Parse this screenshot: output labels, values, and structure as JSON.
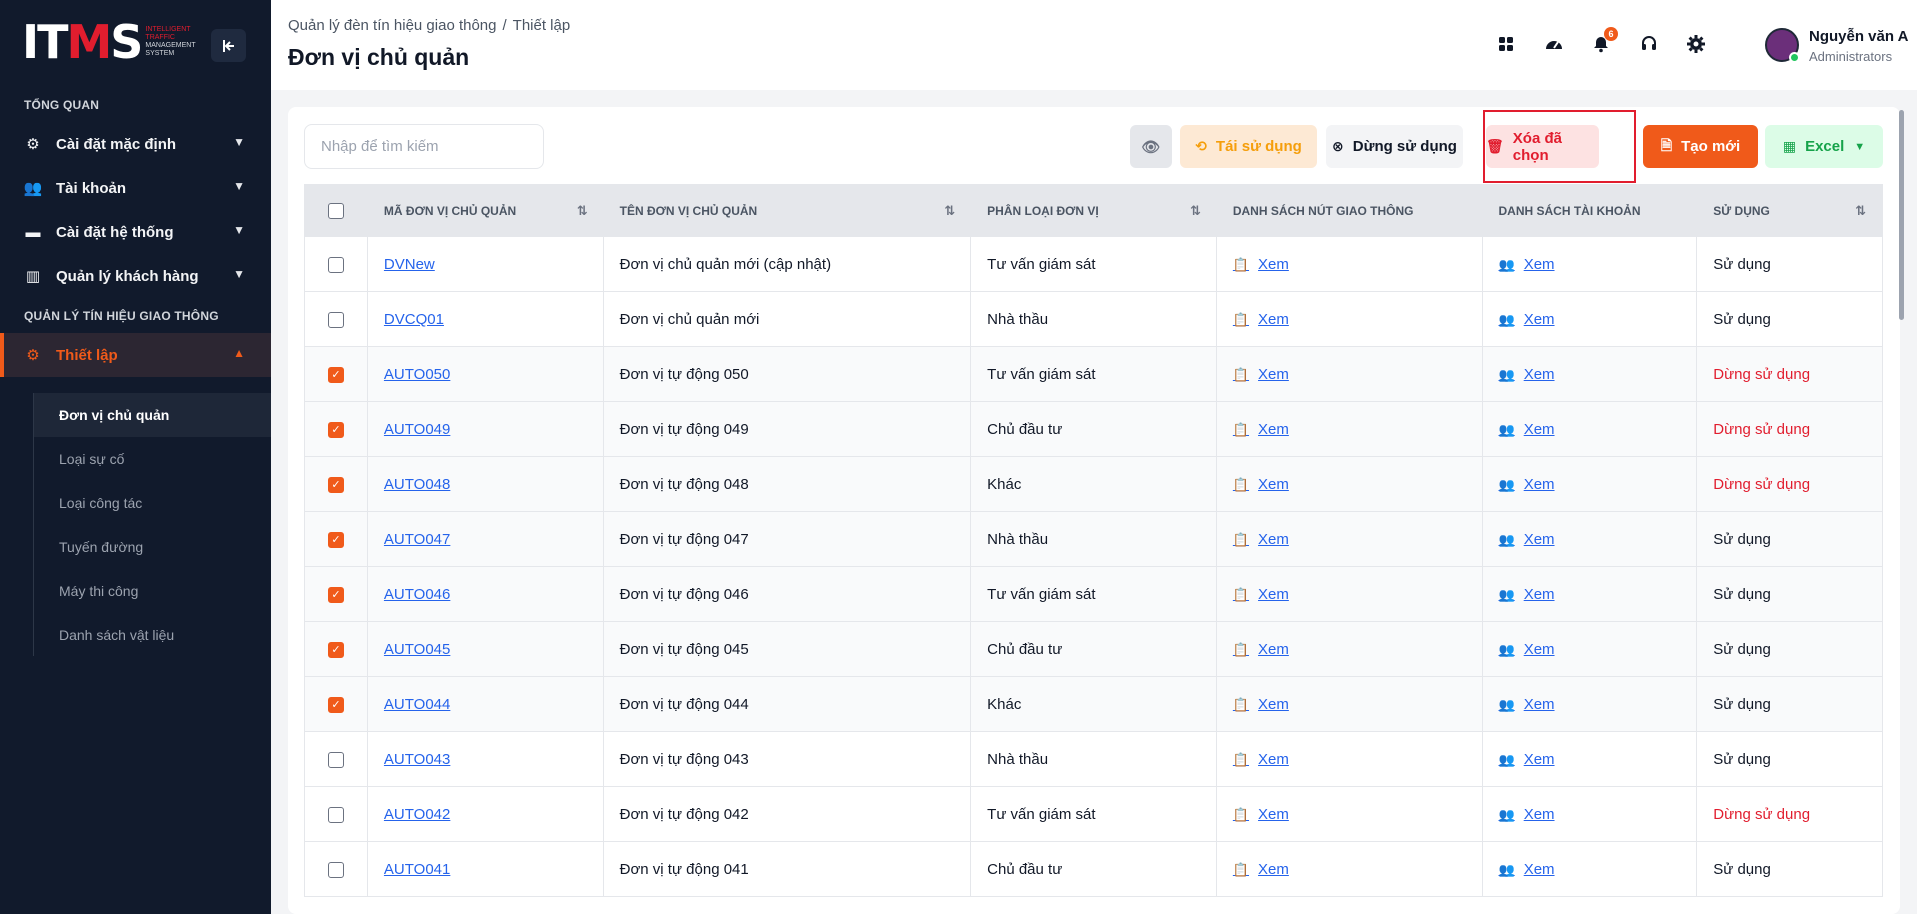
{
  "logo": {
    "mark_a": "IT",
    "mark_b": "M",
    "mark_c": "S",
    "sub1": "INTELLIGENT",
    "sub2": "TRAFFIC",
    "sub3": "MANAGEMENT",
    "sub4": "SYSTEM"
  },
  "sidebar": {
    "section_overview": "TỔNG QUAN",
    "section_traffic": "QUẢN LÝ TÍN HIỆU GIAO THÔNG",
    "items": [
      {
        "label": "Cài đặt mặc định",
        "icon": "gear-icon"
      },
      {
        "label": "Tài khoản",
        "icon": "users-icon"
      },
      {
        "label": "Cài đặt hệ thống",
        "icon": "monitor-icon"
      },
      {
        "label": "Quản lý khách hàng",
        "icon": "building-icon"
      },
      {
        "label": "Thiết lập",
        "icon": "gear-icon"
      }
    ],
    "subitems": [
      {
        "label": "Đơn vị chủ quản"
      },
      {
        "label": "Loại sự cố"
      },
      {
        "label": "Loại công tác"
      },
      {
        "label": "Tuyến đường"
      },
      {
        "label": "Máy thi công"
      },
      {
        "label": "Danh sách vật liệu"
      }
    ]
  },
  "header": {
    "breadcrumb_root": "Quản lý đèn tín hiệu giao thông",
    "breadcrumb_sep": "/",
    "breadcrumb_current": "Thiết lập",
    "title": "Đơn vị chủ quản",
    "notification_count": "6",
    "user_name": "Nguyễn văn A",
    "user_role": "Administrators"
  },
  "toolbar": {
    "search_placeholder": "Nhập để tìm kiếm",
    "reuse_label": "Tái sử dụng",
    "stop_label": "Dừng sử dụng",
    "delete_label": "Xóa đã chọn",
    "create_label": "Tạo mới",
    "excel_label": "Excel"
  },
  "table": {
    "headers": [
      "MÃ ĐƠN VỊ CHỦ QUẢN",
      "TÊN ĐƠN VỊ CHỦ QUẢN",
      "PHÂN LOẠI ĐƠN VỊ",
      "DANH SÁCH NÚT GIAO THÔNG",
      "DANH SÁCH TÀI KHOẢN",
      "SỬ DỤNG"
    ],
    "view_label": "Xem",
    "rows": [
      {
        "checked": false,
        "code": "DVNew",
        "name": "Đơn vị chủ quản mới (cập nhật)",
        "type": "Tư vấn giám sát",
        "status": "Sử dụng",
        "active": true
      },
      {
        "checked": false,
        "code": "DVCQ01",
        "name": "Đơn vị chủ quản mới",
        "type": "Nhà thầu",
        "status": "Sử dụng",
        "active": true
      },
      {
        "checked": true,
        "code": "AUTO050",
        "name": "Đơn vị tự động 050",
        "type": "Tư vấn giám sát",
        "status": "Dừng sử dụng",
        "active": false
      },
      {
        "checked": true,
        "code": "AUTO049",
        "name": "Đơn vị tự động 049",
        "type": "Chủ đầu tư",
        "status": "Dừng sử dụng",
        "active": false
      },
      {
        "checked": true,
        "code": "AUTO048",
        "name": "Đơn vị tự động 048",
        "type": "Khác",
        "status": "Dừng sử dụng",
        "active": false
      },
      {
        "checked": true,
        "code": "AUTO047",
        "name": "Đơn vị tự động 047",
        "type": "Nhà thầu",
        "status": "Sử dụng",
        "active": true
      },
      {
        "checked": true,
        "code": "AUTO046",
        "name": "Đơn vị tự động 046",
        "type": "Tư vấn giám sát",
        "status": "Sử dụng",
        "active": true
      },
      {
        "checked": true,
        "code": "AUTO045",
        "name": "Đơn vị tự động 045",
        "type": "Chủ đầu tư",
        "status": "Sử dụng",
        "active": true
      },
      {
        "checked": true,
        "code": "AUTO044",
        "name": "Đơn vị tự động 044",
        "type": "Khác",
        "status": "Sử dụng",
        "active": true
      },
      {
        "checked": false,
        "code": "AUTO043",
        "name": "Đơn vị tự động 043",
        "type": "Nhà thầu",
        "status": "Sử dụng",
        "active": true
      },
      {
        "checked": false,
        "code": "AUTO042",
        "name": "Đơn vị tự động 042",
        "type": "Tư vấn giám sát",
        "status": "Dừng sử dụng",
        "active": false
      },
      {
        "checked": false,
        "code": "AUTO041",
        "name": "Đơn vị tự động 041",
        "type": "Chủ đầu tư",
        "status": "Sử dụng",
        "active": true
      }
    ]
  },
  "colors": {
    "accent": "#f05a1a",
    "sidebar_bg": "#111a2c",
    "danger": "#e11d2e",
    "link": "#2563eb"
  }
}
